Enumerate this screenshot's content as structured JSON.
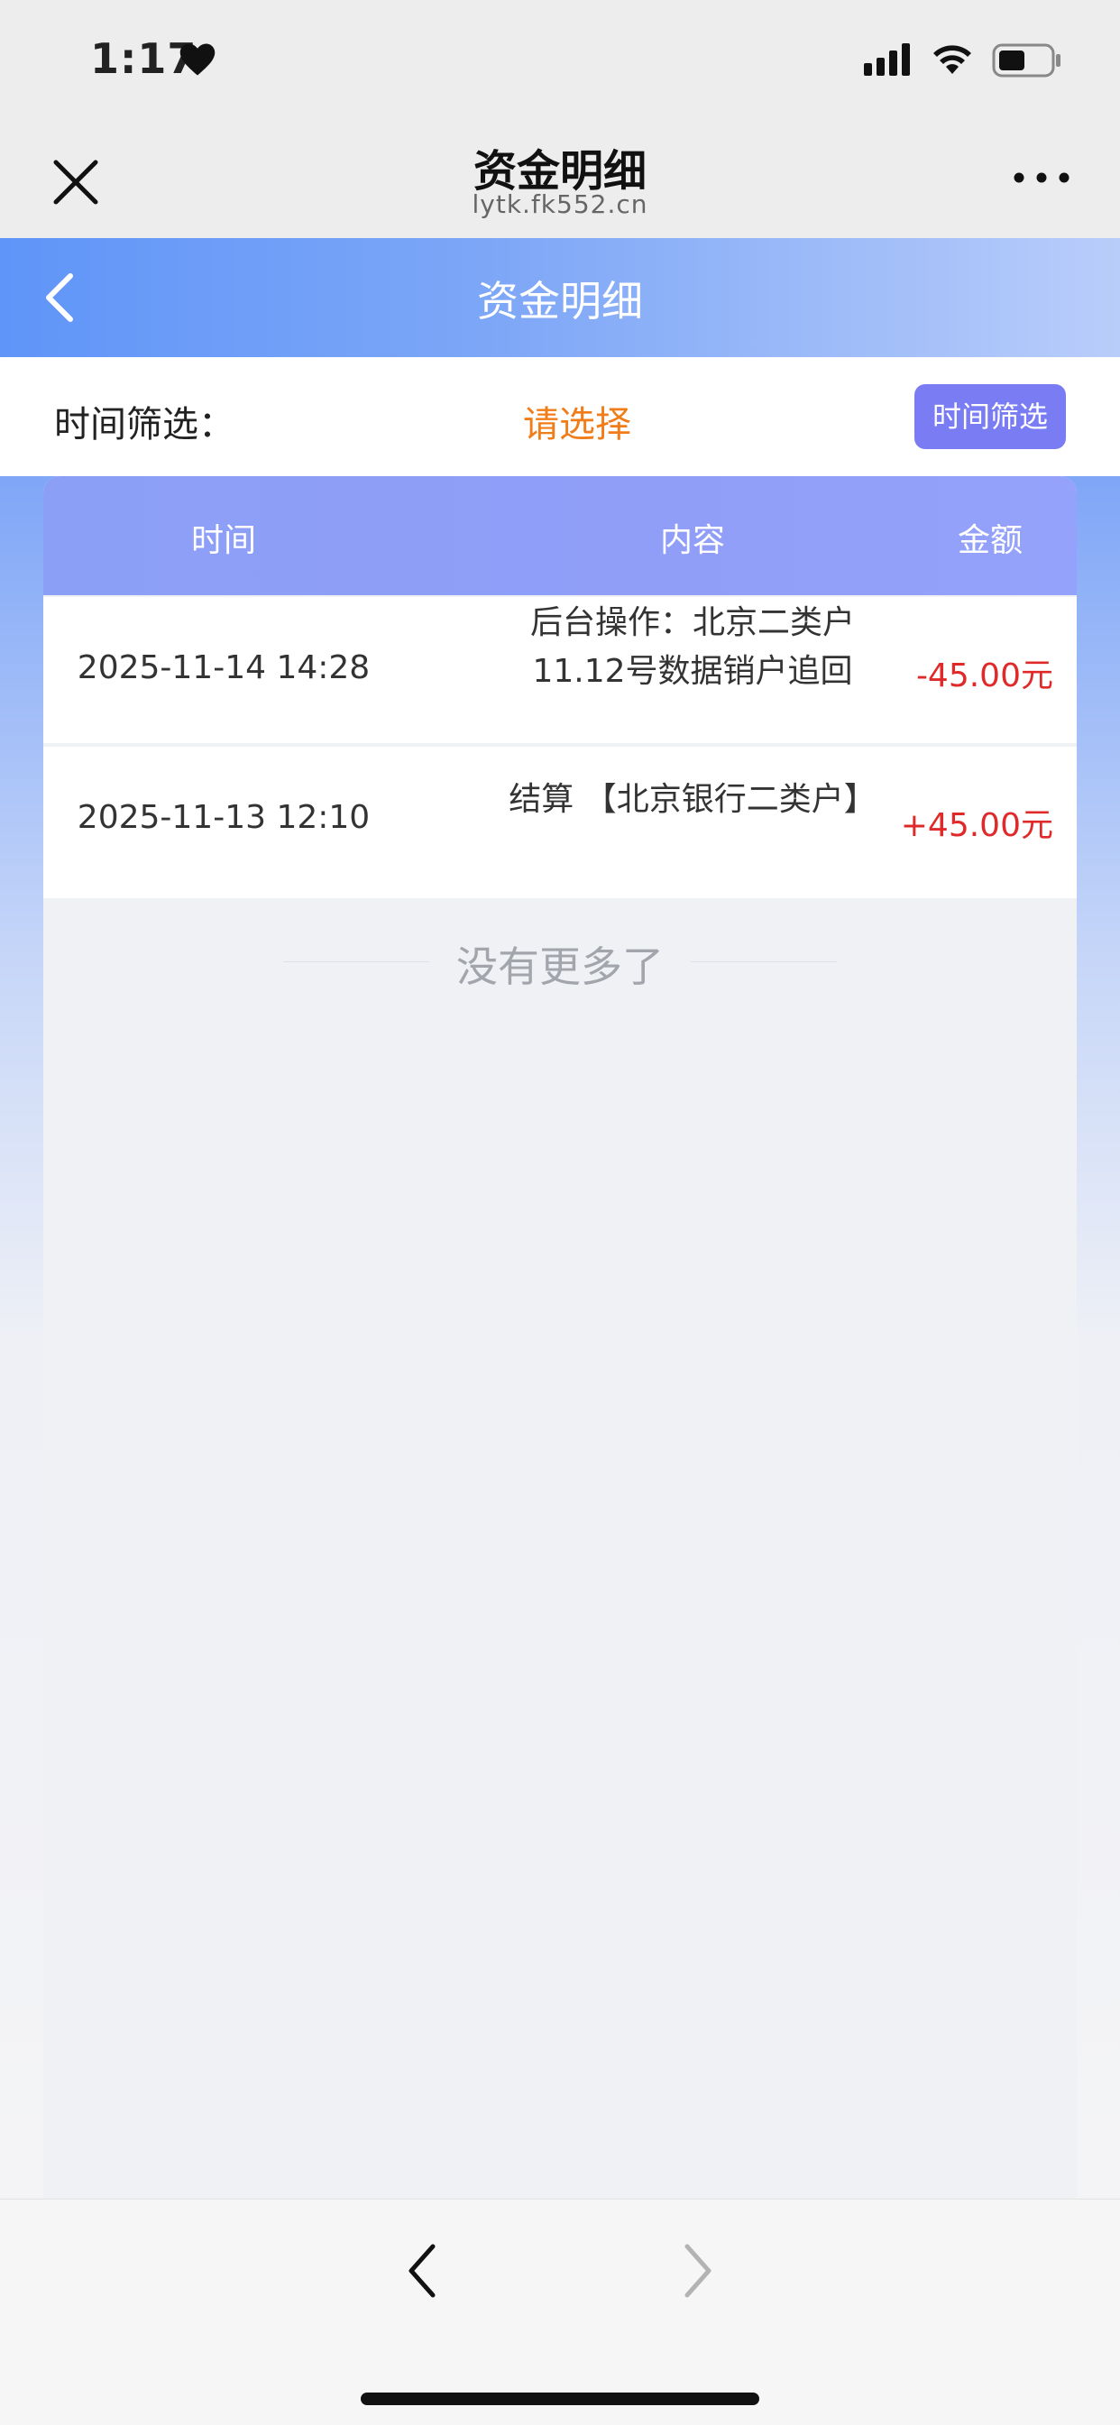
{
  "status_bar": {
    "time": "1:17"
  },
  "wechat_bar": {
    "title": "资金明细",
    "domain": "lytk.fk552.cn"
  },
  "header": {
    "title": "资金明细"
  },
  "filter": {
    "label": "时间筛选：",
    "placeholder": "请选择",
    "button": "时间筛选"
  },
  "table": {
    "columns": [
      "时间",
      "内容",
      "金额"
    ],
    "rows": [
      {
        "time": "2025-11-14 14:28",
        "content": "后台操作：北京二类户11.12号数据销户追回",
        "amount": "-45.00元"
      },
      {
        "time": "2025-11-13 12:10",
        "content": "结算 【北京银行二类户】",
        "amount": "+45.00元"
      }
    ]
  },
  "footer_note": "没有更多了",
  "colors": {
    "accent": "#7a7cf3",
    "select": "#f07d1a",
    "amount": "#e02a2a"
  }
}
